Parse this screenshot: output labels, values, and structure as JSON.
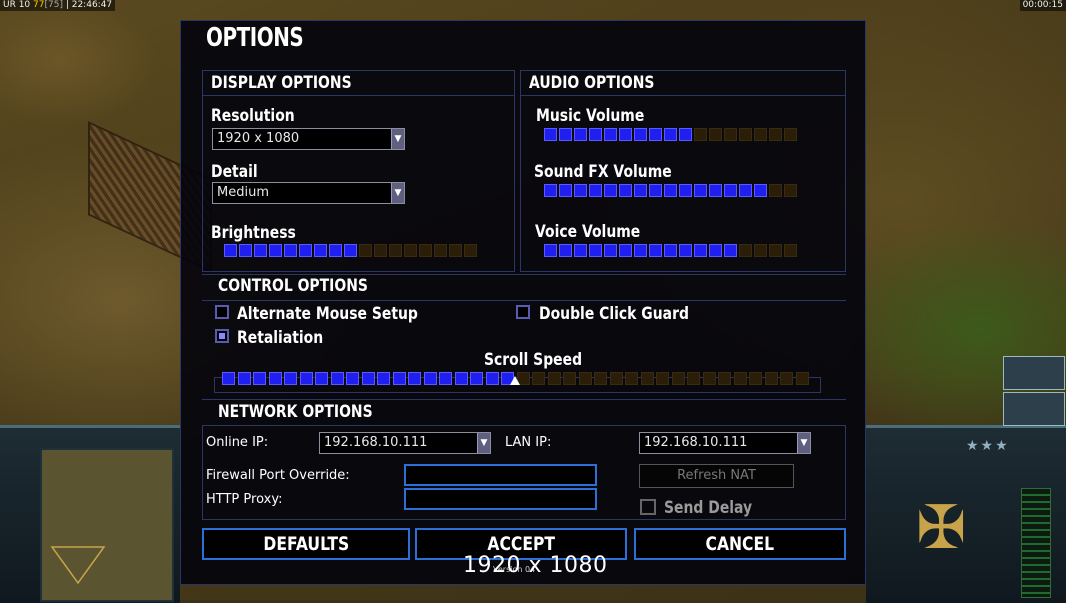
{
  "hud": {
    "stats_prefix": "UR 10",
    "stats_fps": "77",
    "stats_bracket": "[75]",
    "clock": "22:46:47",
    "game_timer": "00:00:15"
  },
  "options": {
    "title": "OPTIONS",
    "display": {
      "title": "DISPLAY OPTIONS",
      "resolution_label": "Resolution",
      "resolution_value": "1920 x 1080",
      "detail_label": "Detail",
      "detail_value": "Medium",
      "brightness_label": "Brightness",
      "brightness_level": 9,
      "brightness_total": 17
    },
    "audio": {
      "title": "AUDIO OPTIONS",
      "music_label": "Music Volume",
      "music_level": 10,
      "music_total": 17,
      "sfx_label": "Sound FX Volume",
      "sfx_level": 15,
      "sfx_total": 17,
      "voice_label": "Voice Volume",
      "voice_level": 13,
      "voice_total": 17
    },
    "control": {
      "title": "CONTROL OPTIONS",
      "alt_mouse_label": "Alternate Mouse Setup",
      "alt_mouse_checked": false,
      "double_click_label": "Double Click Guard",
      "double_click_checked": false,
      "retaliation_label": "Retaliation",
      "retaliation_checked": true,
      "scroll_label": "Scroll Speed",
      "scroll_level": 19,
      "scroll_total": 38
    },
    "network": {
      "title": "NETWORK OPTIONS",
      "online_ip_label": "Online IP:",
      "online_ip_value": "192.168.10.111",
      "lan_ip_label": "LAN IP:",
      "lan_ip_value": "192.168.10.111",
      "firewall_label": "Firewall Port Override:",
      "firewall_value": "",
      "proxy_label": "HTTP Proxy:",
      "proxy_value": "",
      "refresh_nat_label": "Refresh NAT",
      "send_delay_label": "Send Delay",
      "send_delay_checked": false
    },
    "buttons": {
      "defaults": "DEFAULTS",
      "accept": "ACCEPT",
      "cancel": "CANCEL"
    },
    "version": "Version 04",
    "resolution_overlay": "1920 x 1080"
  },
  "colors": {
    "accent_blue": "#2d6fd8",
    "slider_on": "#1f1ff0",
    "slider_off": "#2a1e08",
    "panel_border": "#2b3566"
  }
}
